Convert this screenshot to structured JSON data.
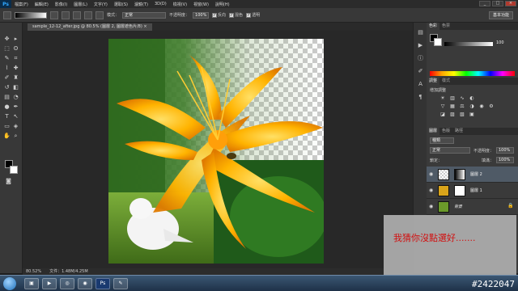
{
  "app": {
    "logo": "Ps"
  },
  "menu": [
    "檔案(F)",
    "編輯(E)",
    "影像(I)",
    "圖層(L)",
    "文字(Y)",
    "選取(S)",
    "濾鏡(T)",
    "3D(D)",
    "檢視(V)",
    "視窗(W)",
    "說明(H)"
  ],
  "window_controls": [
    "_",
    "□",
    "×"
  ],
  "options": {
    "mode_label": "模式：",
    "mode_value": "正常",
    "opacity_label": "不透明度：",
    "opacity_value": "100%",
    "reverse_label": "反向",
    "dither_label": "混色",
    "transparency_label": "透明"
  },
  "workspace": "基本功能",
  "document": {
    "tab_title": "sample_12-12_after.jpg @ 80.5% (圖層 2, 圖層遮色片/8) ×"
  },
  "panels": {
    "color_tabs": [
      "色彩",
      "色票"
    ],
    "color_value": "100",
    "adjust_tabs": [
      "調整",
      "樣式"
    ],
    "adjust_title": "增加調整",
    "layers_tabs": [
      "圖層",
      "色版",
      "路徑"
    ],
    "kind_label": "種類",
    "blend_mode": "正常",
    "opacity_label": "不透明度：",
    "opacity_value": "100%",
    "lock_label": "鎖定：",
    "fill_label": "填滿：",
    "fill_value": "100%",
    "layers": [
      {
        "name": "圖層 2"
      },
      {
        "name": "圖層 1"
      },
      {
        "name": "背景"
      }
    ]
  },
  "status": {
    "zoom": "80.52%",
    "doc": "文件：1.48M/4.25M"
  },
  "overlay_text": "我猜你沒點選好.......",
  "watermark": "#2422047",
  "colors": {
    "accent": "#31a8ff",
    "overlay_text": "#d21010"
  },
  "icons": [
    "move-icon",
    "marquee-icon",
    "lasso-icon",
    "quick-select-icon",
    "crop-icon",
    "eyedropper-icon",
    "brush-icon",
    "eraser-icon",
    "gradient-icon",
    "pen-icon",
    "type-icon",
    "hand-icon",
    "zoom-icon",
    "eye-icon"
  ]
}
